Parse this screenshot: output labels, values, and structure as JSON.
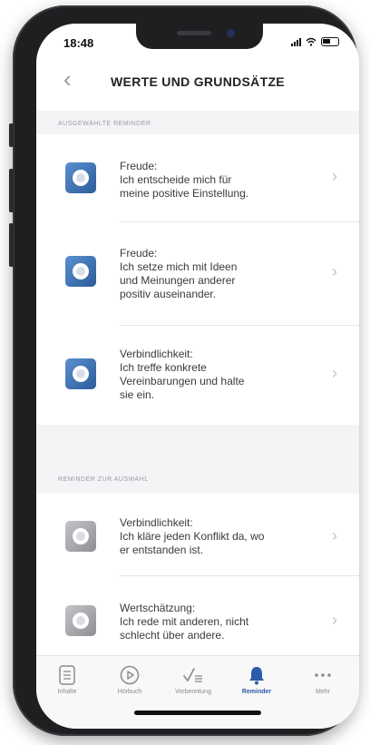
{
  "status": {
    "time": "18:48"
  },
  "nav": {
    "back": "‹",
    "title": "WERTE UND GRUNDSÄTZE"
  },
  "sections": {
    "selected": "AUSGEWÄHLTE REMINDER",
    "available": "REMINDER ZUR AUSWAHL"
  },
  "selected_items": [
    {
      "text": "Freude:\nIch entscheide mich für\nmeine positive Einstellung."
    },
    {
      "text": "Freude:\nIch setze mich mit Ideen\nund Meinungen anderer\npositiv auseinander."
    },
    {
      "text": "Verbindlichkeit:\nIch treffe konkrete\nVereinbarungen und halte\nsie ein."
    }
  ],
  "available_items": [
    {
      "text": "Verbindlichkeit:\nIch kläre jeden Konflikt da, wo\ner entstanden ist."
    },
    {
      "text": "Wertschätzung:\nIch rede mit anderen, nicht\nschlecht über andere."
    }
  ],
  "chevron": "›",
  "tabs": [
    {
      "label": "Inhalte",
      "icon": "document-icon"
    },
    {
      "label": "Hörbuch",
      "icon": "play-icon"
    },
    {
      "label": "Vorbereitung",
      "icon": "checklist-icon"
    },
    {
      "label": "Reminder",
      "icon": "bell-icon"
    },
    {
      "label": "Mehr",
      "icon": "more-icon"
    }
  ],
  "colors": {
    "accent": "#2c5ca8",
    "selected_icon": "#3a6fb0",
    "available_icon": "#a8a8ae"
  }
}
